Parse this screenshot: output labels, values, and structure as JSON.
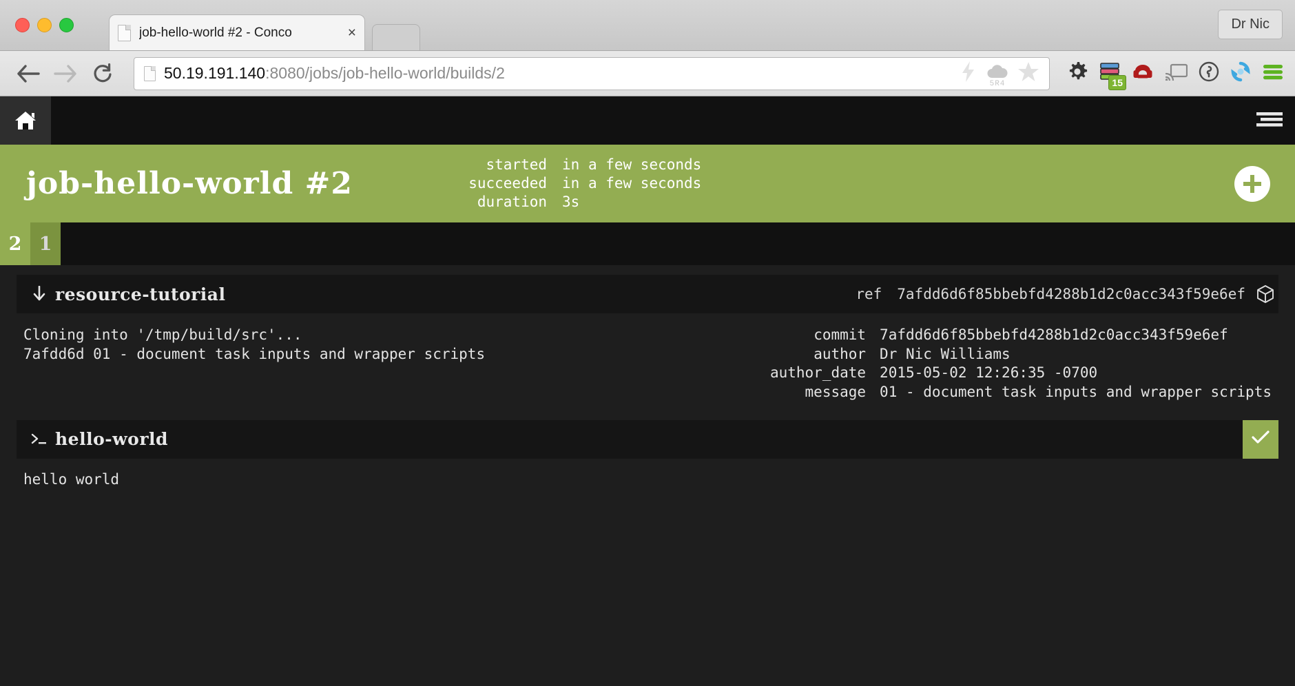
{
  "browser": {
    "tab": {
      "title": "job-hello-world #2 - Conco",
      "close_label": "×",
      "favicon": "page-icon"
    },
    "profile_label": "Dr Nic",
    "nav": {
      "back": "back-arrow-icon",
      "forward": "forward-arrow-icon",
      "reload": "reload-icon"
    },
    "omnibox": {
      "host": "50.19.191.140",
      "path": ":8080/jobs/job-hello-world/builds/2",
      "full_url": "50.19.191.140:8080/jobs/job-hello-world/builds/2",
      "icons": [
        "lightning-icon",
        "cloud-icon",
        "star-icon"
      ],
      "cloud_label": "5R4"
    },
    "extensions": [
      {
        "name": "gear-icon"
      },
      {
        "name": "tab-stack-icon",
        "badge": "15",
        "badge_color": "#7db532"
      },
      {
        "name": "pocket-armchair-icon",
        "color": "#b01b1b"
      },
      {
        "name": "cast-icon"
      },
      {
        "name": "onepassword-icon"
      },
      {
        "name": "sync-refresh-icon",
        "color": "#3ea8e0"
      },
      {
        "name": "hamburger-menu-icon",
        "color": "#5db321"
      }
    ]
  },
  "topbar": {
    "home_icon": "home-icon",
    "menu_icon": "list-menu-icon"
  },
  "build": {
    "title": "job-hello-world #2",
    "status_color": "#93ad52",
    "meta": [
      {
        "key": "started",
        "value": "in a few seconds"
      },
      {
        "key": "succeeded",
        "value": "in a few seconds"
      },
      {
        "key": "duration",
        "value": "3s"
      }
    ],
    "add_button": "plus-icon",
    "tabs": [
      {
        "label": "2",
        "state": "current"
      },
      {
        "label": "1",
        "state": "previous"
      }
    ]
  },
  "steps": [
    {
      "name": "resource-tutorial",
      "icon": "download-arrow-icon",
      "ref_key": "ref",
      "ref_value": "7afdd6d6f85bbebfd4288b1d2c0acc343f59e6ef",
      "trailing_icon": "cube-icon",
      "log": "Cloning into '/tmp/build/src'...\n7afdd6d 01 - document task inputs and wrapper scripts",
      "metadata": [
        {
          "key": "commit",
          "value": "7afdd6d6f85bbebfd4288b1d2c0acc343f59e6ef"
        },
        {
          "key": "author",
          "value": "Dr Nic Williams"
        },
        {
          "key": "author_date",
          "value": "2015-05-02 12:26:35 -0700"
        },
        {
          "key": "message",
          "value": "01 - document task inputs and wrapper scripts"
        }
      ]
    },
    {
      "name": "hello-world",
      "icon": "terminal-prompt-icon",
      "status_icon": "check-icon",
      "status_color": "#93ad52",
      "output": "hello world"
    }
  ]
}
